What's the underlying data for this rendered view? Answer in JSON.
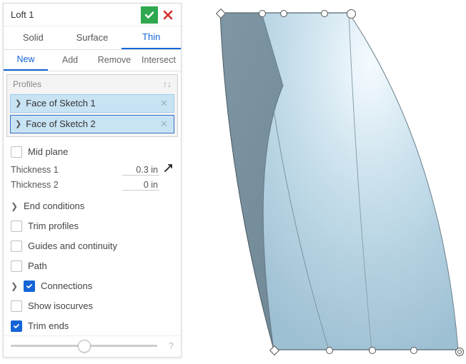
{
  "header": {
    "title": "Loft 1"
  },
  "tabs": {
    "items": [
      "Solid",
      "Surface",
      "Thin"
    ],
    "active": "Thin"
  },
  "ops": {
    "items": [
      "New",
      "Add",
      "Remove",
      "Intersect"
    ],
    "active": "New"
  },
  "profiles": {
    "label": "Profiles",
    "items": [
      {
        "label": "Face of Sketch 1"
      },
      {
        "label": "Face of Sketch 2"
      }
    ]
  },
  "options": {
    "mid_plane": {
      "label": "Mid plane",
      "checked": false
    },
    "thickness1": {
      "label": "Thickness 1",
      "value": "0.3 in"
    },
    "thickness2": {
      "label": "Thickness 2",
      "value": "0 in"
    },
    "end_conditions": {
      "label": "End conditions"
    },
    "trim_profiles": {
      "label": "Trim profiles",
      "checked": false
    },
    "guides": {
      "label": "Guides and continuity",
      "checked": false
    },
    "path": {
      "label": "Path",
      "checked": false
    },
    "connections": {
      "label": "Connections",
      "checked": true
    },
    "show_iso": {
      "label": "Show isocurves",
      "checked": false
    },
    "trim_ends": {
      "label": "Trim ends",
      "checked": true
    }
  }
}
